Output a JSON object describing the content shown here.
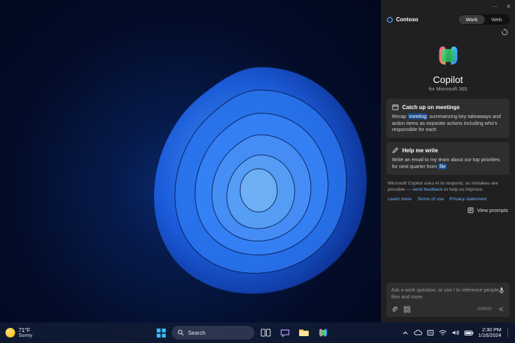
{
  "copilot": {
    "more_menu": "⋯",
    "close": "✕",
    "org_name": "Contoso",
    "toggle": {
      "work": "Work",
      "web": "Web"
    },
    "hero": {
      "title": "Copilot",
      "subtitle": "for Microsoft 365"
    },
    "cards": [
      {
        "icon": "calendar-icon",
        "title": "Catch up on meetings",
        "desc_pre": "Recap ",
        "chip": "meeting",
        "desc_post": " summarizing key takeaways and action items as separate actions including who's responsible for each"
      },
      {
        "icon": "pen-icon",
        "title": "Help me write",
        "desc_pre": "Write an email to my team about our top priorities for next quarter from ",
        "chip": "file",
        "desc_post": ""
      }
    ],
    "disclaimer_pre": "Microsoft Copilot uses AI to respond, so mistakes are possible — ",
    "disclaimer_link": "send feedback",
    "disclaimer_post": " to help us improve.",
    "links": {
      "learn": "Learn more",
      "terms": "Terms of use",
      "privacy": "Privacy statement"
    },
    "view_prompts": "View prompts",
    "input": {
      "placeholder": "Ask a work question, or use / to reference people, files and more",
      "counter": "0/4000"
    }
  },
  "taskbar": {
    "weather": {
      "temp": "71°F",
      "cond": "Sunny"
    },
    "search_placeholder": "Search",
    "time": "2:30 PM",
    "date": "1/16/2024"
  }
}
